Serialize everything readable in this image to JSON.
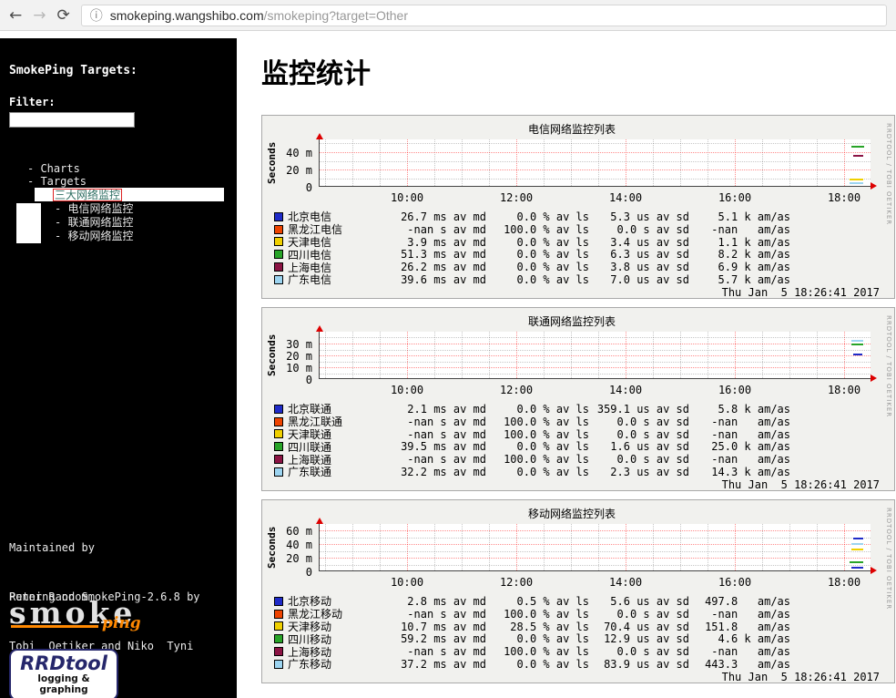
{
  "browser": {
    "icons": {
      "back": "←",
      "forward": "→",
      "refresh": "⟳",
      "info": "ⓘ"
    },
    "url_domain": "smokeping.wangshibo.com",
    "url_path": "/smokeping?target=Other"
  },
  "sidebar": {
    "title": "SmokePing Targets:",
    "filter_label": "Filter:",
    "filter_value": "",
    "tree": {
      "items": [
        "- Charts",
        "- Targets"
      ],
      "selected": "三大网络监控",
      "children": [
        "- 电信网络监控",
        "- 联通网络监控",
        "- 移动网络监控"
      ]
    },
    "maintained_line1": "Maintained by",
    "maintained_line2": "Peter Random",
    "running_line1": "Running on SmokePing-2.6.8 by",
    "running_line2": "Tobi  Oetiker and Niko  Tyni",
    "logo_smoke": "smoke",
    "logo_ping": "ping",
    "rrd_logo": {
      "title": "RRDtool",
      "subtitle": "logging & graphing"
    }
  },
  "main": {
    "page_title": "监控统计"
  },
  "chart_data": [
    {
      "type": "line",
      "title": "电信网络监控列表",
      "ylabel": "Seconds",
      "x_ticks": [
        "10:00",
        "12:00",
        "14:00",
        "16:00",
        "18:00"
      ],
      "y_ticks": [
        {
          "label": "40 m",
          "frac": 0.27
        },
        {
          "label": "20 m",
          "frac": 0.63
        },
        {
          "label": "0",
          "frac": 1.0
        }
      ],
      "watermark": "RRDTOOL / TOBI OETIKER",
      "timestamp": "Thu Jan  5 18:26:41 2017",
      "series": [
        {
          "name": "北京电信",
          "color": "#1f2bc8",
          "cells": [
            "26.7 ms av md",
            "0.0 % av ls",
            "5.3 us av sd",
            "5.1 k am/as"
          ]
        },
        {
          "name": "黑龙江电信",
          "color": "#ee4400",
          "cells": [
            "-nan s av md",
            "100.0 % av ls",
            "0.0 s av sd",
            "-nan   am/as"
          ]
        },
        {
          "name": "天津电信",
          "color": "#f0d000",
          "cells": [
            "3.9 ms av md",
            "0.0 % av ls",
            "3.4 us av sd",
            "1.1 k am/as"
          ]
        },
        {
          "name": "四川电信",
          "color": "#28a428",
          "cells": [
            "51.3 ms av md",
            "0.0 % av ls",
            "6.3 us av sd",
            "8.2 k am/as"
          ]
        },
        {
          "name": "上海电信",
          "color": "#8c1444",
          "cells": [
            "26.2 ms av md",
            "0.0 % av ls",
            "3.8 us av sd",
            "6.9 k am/as"
          ]
        },
        {
          "name": "广东电信",
          "color": "#9cd4f0",
          "cells": [
            "39.6 ms av md",
            "0.0 % av ls",
            "7.0 us av sd",
            "5.7 k am/as"
          ]
        }
      ],
      "segments": [
        {
          "x": 584,
          "y": 7,
          "w": 14,
          "color": "#28a428"
        },
        {
          "x": 586,
          "y": 17,
          "w": 11,
          "color": "#8c1444"
        },
        {
          "x": 582,
          "y": 43,
          "w": 15,
          "color": "#f0d000"
        },
        {
          "x": 582,
          "y": 47,
          "w": 15,
          "color": "#9cd4f0"
        }
      ]
    },
    {
      "type": "line",
      "title": "联通网络监控列表",
      "ylabel": "Seconds",
      "x_ticks": [
        "10:00",
        "12:00",
        "14:00",
        "16:00",
        "18:00"
      ],
      "y_ticks": [
        {
          "label": "30 m",
          "frac": 0.25
        },
        {
          "label": "20 m",
          "frac": 0.5
        },
        {
          "label": "10 m",
          "frac": 0.75
        },
        {
          "label": "0",
          "frac": 1.0
        }
      ],
      "watermark": "RRDTOOL / TOBI OETIKER",
      "timestamp": "Thu Jan  5 18:26:41 2017",
      "series": [
        {
          "name": "北京联通",
          "color": "#1f2bc8",
          "cells": [
            "2.1 ms av md",
            "0.0 % av ls",
            "359.1 us av sd",
            "5.8 k am/as"
          ]
        },
        {
          "name": "黑龙江联通",
          "color": "#ee4400",
          "cells": [
            "-nan s av md",
            "100.0 % av ls",
            "0.0 s av sd",
            "-nan   am/as"
          ]
        },
        {
          "name": "天津联通",
          "color": "#f0d000",
          "cells": [
            "-nan s av md",
            "100.0 % av ls",
            "0.0 s av sd",
            "-nan   am/as"
          ]
        },
        {
          "name": "四川联通",
          "color": "#28a428",
          "cells": [
            "39.5 ms av md",
            "0.0 % av ls",
            "1.6 us av sd",
            "25.0 k am/as"
          ]
        },
        {
          "name": "上海联通",
          "color": "#8c1444",
          "cells": [
            "-nan s av md",
            "100.0 % av ls",
            "0.0 s av sd",
            "-nan   am/as"
          ]
        },
        {
          "name": "广东联通",
          "color": "#9cd4f0",
          "cells": [
            "32.2 ms av md",
            "0.0 % av ls",
            "2.3 us av sd",
            "14.3 k am/as"
          ]
        }
      ],
      "segments": [
        {
          "x": 584,
          "y": 9,
          "w": 13,
          "color": "#9cd4f0"
        },
        {
          "x": 584,
          "y": 13,
          "w": 13,
          "color": "#28a428"
        },
        {
          "x": 586,
          "y": 24,
          "w": 10,
          "color": "#1f2bc8"
        }
      ]
    },
    {
      "type": "line",
      "title": "移动网络监控列表",
      "ylabel": "Seconds",
      "x_ticks": [
        "10:00",
        "12:00",
        "14:00",
        "16:00",
        "18:00"
      ],
      "y_ticks": [
        {
          "label": "60 m",
          "frac": 0.13
        },
        {
          "label": "40 m",
          "frac": 0.42
        },
        {
          "label": "20 m",
          "frac": 0.71
        },
        {
          "label": "0",
          "frac": 1.0
        }
      ],
      "watermark": "RRDTOOL / TOBI OETIKER",
      "timestamp": "Thu Jan  5 18:26:41 2017",
      "series": [
        {
          "name": "北京移动",
          "color": "#1f2bc8",
          "cells": [
            "2.8 ms av md",
            "0.5 % av ls",
            "5.6 us av sd",
            "497.8   am/as"
          ]
        },
        {
          "name": "黑龙江移动",
          "color": "#ee4400",
          "cells": [
            "-nan s av md",
            "100.0 % av ls",
            "0.0 s av sd",
            "-nan   am/as"
          ]
        },
        {
          "name": "天津移动",
          "color": "#f0d000",
          "cells": [
            "10.7 ms av md",
            "28.5 % av ls",
            "70.4 us av sd",
            "151.8   am/as"
          ]
        },
        {
          "name": "四川移动",
          "color": "#28a428",
          "cells": [
            "59.2 ms av md",
            "0.0 % av ls",
            "12.9 us av sd",
            "4.6 k am/as"
          ]
        },
        {
          "name": "上海移动",
          "color": "#8c1444",
          "cells": [
            "-nan s av md",
            "100.0 % av ls",
            "0.0 s av sd",
            "-nan   am/as"
          ]
        },
        {
          "name": "广东移动",
          "color": "#9cd4f0",
          "cells": [
            "37.2 ms av md",
            "0.0 % av ls",
            "83.9 us av sd",
            "443.3   am/as"
          ]
        }
      ],
      "segments": [
        {
          "x": 586,
          "y": 15,
          "w": 11,
          "color": "#1f2bc8"
        },
        {
          "x": 584,
          "y": 21,
          "w": 13,
          "color": "#9cd4f0"
        },
        {
          "x": 584,
          "y": 27,
          "w": 13,
          "color": "#f0d000"
        },
        {
          "x": 582,
          "y": 41,
          "w": 15,
          "color": "#28a428"
        },
        {
          "x": 584,
          "y": 47,
          "w": 13,
          "color": "#1f2bc8"
        }
      ]
    }
  ]
}
